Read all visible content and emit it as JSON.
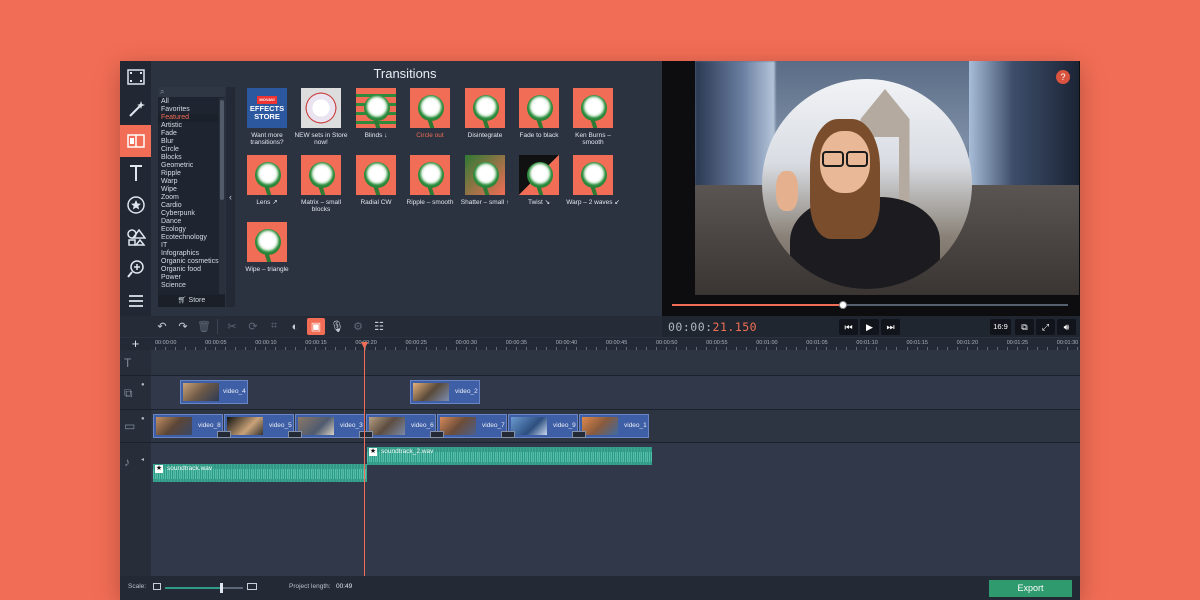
{
  "panel": {
    "title": "Transitions"
  },
  "categories": [
    "All",
    "Favorites",
    "Featured",
    "Artistic",
    "Fade",
    "Blur",
    "Circle",
    "Blocks",
    "Geometric",
    "Ripple",
    "Warp",
    "Wipe",
    "Zoom",
    "Cardio",
    "Cyberpunk",
    "Dance",
    "Ecology",
    "Ecotechnology",
    "IT",
    "Infographics",
    "Organic cosmetics",
    "Organic food",
    "Power",
    "Science"
  ],
  "selected_category": "Featured",
  "store_label": "Store",
  "transitions": [
    {
      "label": "Want more transitions?",
      "thumb": "effects-store"
    },
    {
      "label": "NEW sets in Store now!",
      "thumb": "store-sets"
    },
    {
      "label": "Blinds ↓",
      "thumb": "flower"
    },
    {
      "label": "Circle out",
      "thumb": "flower",
      "highlight": true
    },
    {
      "label": "Disintegrate",
      "thumb": "flower"
    },
    {
      "label": "Fade to black",
      "thumb": "flower"
    },
    {
      "label": "Ken Burns – smooth",
      "thumb": "flower"
    },
    {
      "label": "Lens ↗",
      "thumb": "flower"
    },
    {
      "label": "Matrix – small blocks",
      "thumb": "flower"
    },
    {
      "label": "Radial CW",
      "thumb": "flower"
    },
    {
      "label": "Ripple – smooth",
      "thumb": "flower"
    },
    {
      "label": "Shatter – small ↑",
      "thumb": "flower"
    },
    {
      "label": "Twist ↘",
      "thumb": "flower"
    },
    {
      "label": "Warp – 2 waves ↙",
      "thumb": "flower"
    },
    {
      "label": "Wipe – triangle",
      "thumb": "flower"
    }
  ],
  "effects_store_tile": {
    "tag": "MOVAVI",
    "line1": "EFFECTS",
    "line2": "STORE"
  },
  "player": {
    "timecode_main": "00:00:",
    "timecode_red": "21.150",
    "progress": 0.43,
    "ratio": "16:9",
    "help": "?"
  },
  "ruler": [
    "00:00:00",
    "00:00:05",
    "00:00:10",
    "00:00:15",
    "00:00:20",
    "00:00:25",
    "00:00:30",
    "00:00:35",
    "00:00:40",
    "00:00:45",
    "00:00:50",
    "00:00:55",
    "00:01:00",
    "00:01:05",
    "00:01:10",
    "00:01:15",
    "00:01:20",
    "00:01:25",
    "00:01:30"
  ],
  "overlay_clips": [
    "video_4",
    "video_2"
  ],
  "main_clips": [
    "video_8",
    "video_5",
    "video_3",
    "video_6",
    "video_7",
    "video_9",
    "video_1"
  ],
  "audio_clips": [
    "soundtrack.wav",
    "soundtrack_2.wav"
  ],
  "bottom": {
    "scale_label": "Scale:",
    "scale_level": 0.72,
    "project_length_label": "Project length:",
    "project_length": "00:49",
    "export_label": "Export"
  },
  "colors": {
    "accent": "#f26d55",
    "audio": "#2f9a86",
    "clip": "#3e5ea6",
    "export": "#2e9a6e"
  }
}
